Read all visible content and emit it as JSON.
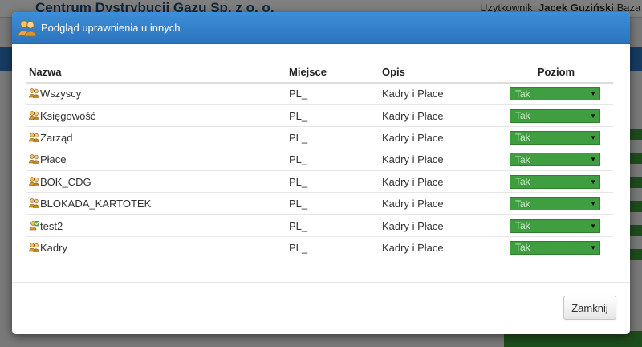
{
  "background": {
    "app_title": "Centrum Dystrybucji Gazu Sp. z o. o.",
    "user_label": "Użytkownik:",
    "user_name": "Jacek Guziński",
    "user_suffix": "Baza"
  },
  "modal": {
    "title": "Podgląd uprawnienia u innych",
    "title_icon": "users-icon",
    "columns": {
      "name": "Nazwa",
      "place": "Miejsce",
      "description": "Opis",
      "level": "Poziom"
    },
    "rows": [
      {
        "icon": "group-icon",
        "name": "Wszyscy",
        "place": "PL_",
        "description": "Kadry i Płace",
        "level": "Tak"
      },
      {
        "icon": "group-icon",
        "name": "Księgowość",
        "place": "PL_",
        "description": "Kadry i Płace",
        "level": "Tak"
      },
      {
        "icon": "group-icon",
        "name": "Zarząd",
        "place": "PL_",
        "description": "Kadry i Płace",
        "level": "Tak"
      },
      {
        "icon": "group-icon",
        "name": "Płace",
        "place": "PL_",
        "description": "Kadry i Płace",
        "level": "Tak"
      },
      {
        "icon": "group-icon",
        "name": "BOK_CDG",
        "place": "PL_",
        "description": "Kadry i Płace",
        "level": "Tak"
      },
      {
        "icon": "group-icon",
        "name": "BLOKADA_KARTOTEK",
        "place": "PL_",
        "description": "Kadry i Płace",
        "level": "Tak"
      },
      {
        "icon": "special-group-icon",
        "name": "test2",
        "place": "PL_",
        "description": "Kadry i Płace",
        "level": "Tak"
      },
      {
        "icon": "group-icon",
        "name": "Kadry",
        "place": "PL_",
        "description": "Kadry i Płace",
        "level": "Tak"
      }
    ],
    "close_label": "Zamknij"
  },
  "colors": {
    "header_blue": "#2d78c4",
    "level_green": "#3f9e3f"
  }
}
